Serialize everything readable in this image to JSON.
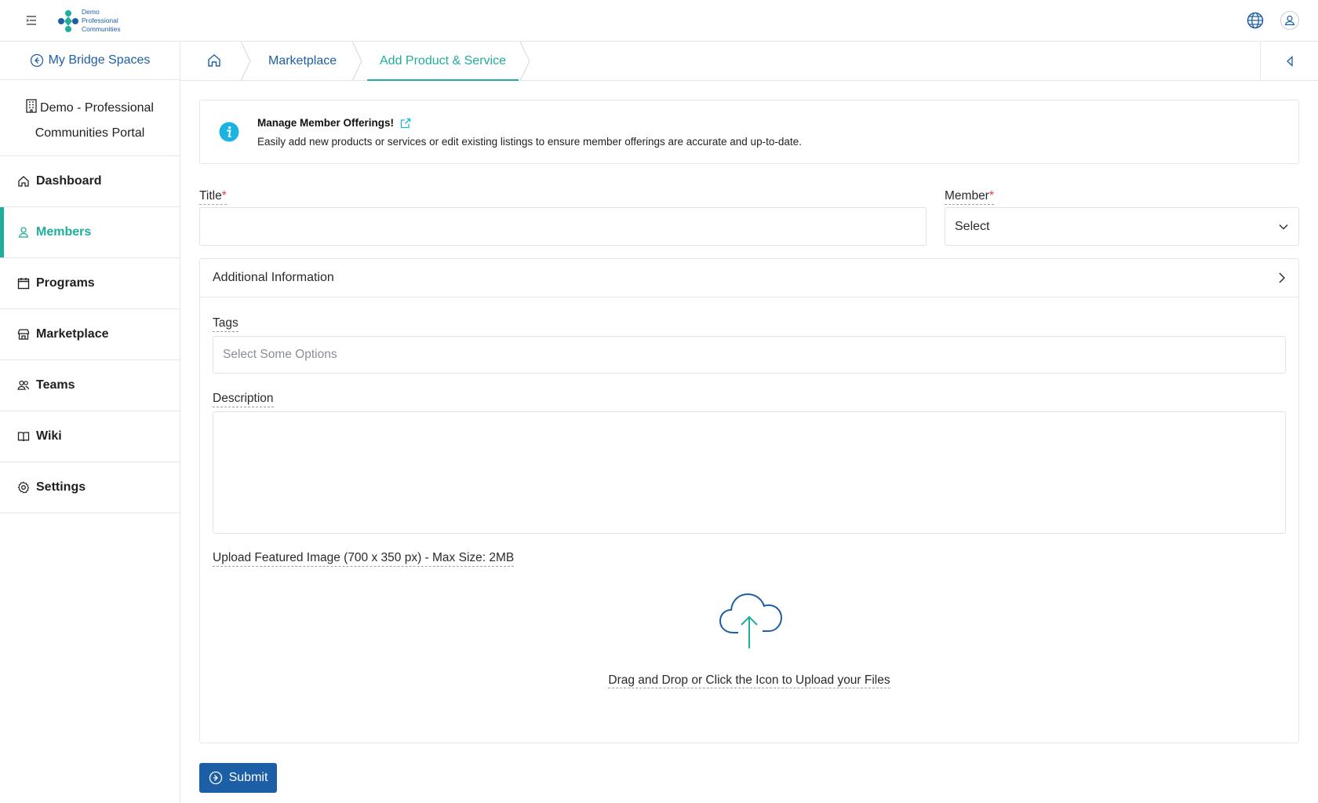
{
  "header": {
    "logo_lines": [
      "Demo",
      "Professional",
      "Communities"
    ]
  },
  "sidebar": {
    "back_label": "My Bridge Spaces",
    "portal_name_line1": "Demo - Professional",
    "portal_name_line2": "Communities Portal",
    "items": [
      {
        "label": "Dashboard",
        "icon": "home-icon"
      },
      {
        "label": "Members",
        "icon": "user-icon",
        "active": true
      },
      {
        "label": "Programs",
        "icon": "calendar-icon"
      },
      {
        "label": "Marketplace",
        "icon": "store-icon"
      },
      {
        "label": "Teams",
        "icon": "users-icon"
      },
      {
        "label": "Wiki",
        "icon": "book-icon"
      },
      {
        "label": "Settings",
        "icon": "gear-icon"
      }
    ]
  },
  "breadcrumb": {
    "items": [
      "Marketplace",
      "Add Product & Service"
    ]
  },
  "info": {
    "title": "Manage Member Offerings!",
    "text": "Easily add new products or services or edit existing listings to ensure member offerings are accurate and up-to-date."
  },
  "form": {
    "title_label": "Title",
    "title_value": "",
    "member_label": "Member",
    "member_value": "Select",
    "required_mark": "*",
    "additional_info_label": "Additional Information",
    "tags_label": "Tags",
    "tags_placeholder": "Select Some Options",
    "description_label": "Description",
    "upload_label": "Upload Featured Image (700 x 350 px) - Max Size: 2MB",
    "upload_text": "Drag and Drop or Click the Icon to Upload your Files",
    "submit_label": "Submit"
  },
  "colors": {
    "primary": "#1d5fa6",
    "accent": "#1fae9b",
    "info": "#1bb3e0"
  }
}
